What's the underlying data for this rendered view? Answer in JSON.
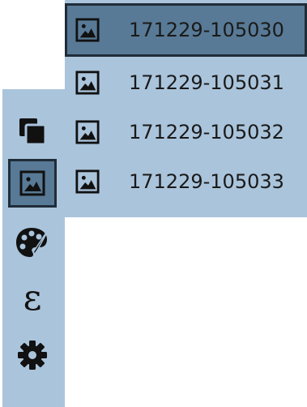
{
  "toolbar": {
    "items": [
      {
        "name": "layers",
        "icon": "layers-icon",
        "active": false
      },
      {
        "name": "image",
        "icon": "image-icon",
        "active": true
      },
      {
        "name": "palette",
        "icon": "palette-icon",
        "active": false
      },
      {
        "name": "effects",
        "icon": "epsilon-icon",
        "active": false
      },
      {
        "name": "settings",
        "icon": "gear-icon",
        "active": false
      }
    ],
    "effects_glyph": "ε"
  },
  "image_list": {
    "items": [
      {
        "label": "171229-105030",
        "selected": true
      },
      {
        "label": "171229-105031",
        "selected": false
      },
      {
        "label": "171229-105032",
        "selected": false
      },
      {
        "label": "171229-105033",
        "selected": false
      }
    ]
  },
  "colors": {
    "panel": "#aac4db",
    "selected": "#587a96",
    "selected_border": "#1f2c38",
    "icon": "#111111"
  }
}
